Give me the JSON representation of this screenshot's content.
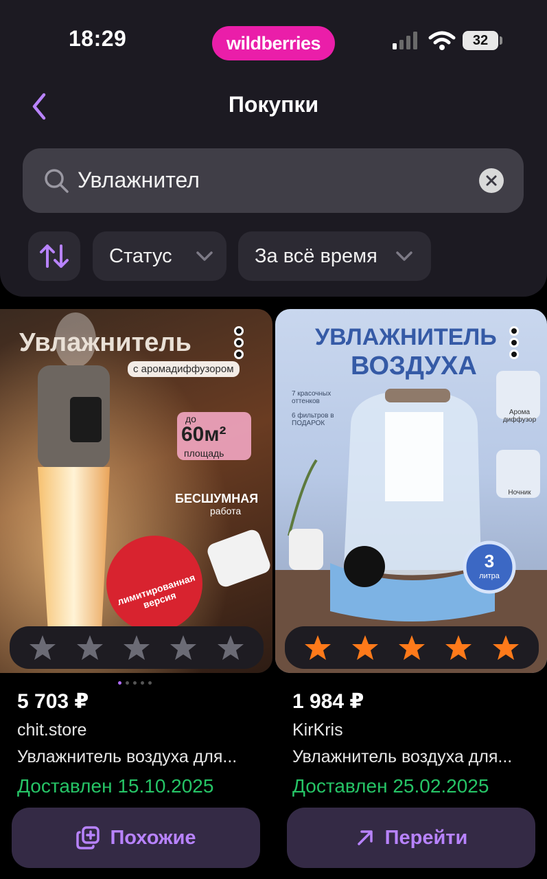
{
  "status_bar": {
    "time": "18:29",
    "brand": "wildberries",
    "battery": "32"
  },
  "header": {
    "title": "Покупки"
  },
  "search": {
    "value": "Увлажнител"
  },
  "filters": {
    "status_label": "Статус",
    "period_label": "За всё время"
  },
  "products": [
    {
      "image_title": "Увлажнитель",
      "image_subtitle": "с аромадиффузором",
      "image_badge_top": "до",
      "image_badge_value": "60м²",
      "image_badge_unit": "площадь",
      "image_feature_1": "БЕСШУМНАЯ",
      "image_feature_2": "работа",
      "image_sticker": "лимитированная версия",
      "rating": 0,
      "price": "5 703 ₽",
      "seller": "chit.store",
      "name": "Увлажнитель воздуха для...",
      "status": "Доставлен 15.10.2025",
      "action_label": "Похожие"
    },
    {
      "image_title_1": "УВЛАЖНИТЕЛЬ",
      "image_title_2": "ВОЗДУХА",
      "image_feature_1": "7 красочных оттенков",
      "image_feature_2": "6 фильтров в ПОДАРОК",
      "image_mode_1": "Арома диффузор",
      "image_mode_2": "Ночник",
      "image_volume_value": "3",
      "image_volume_unit": "литра",
      "rating": 5,
      "price": "1 984 ₽",
      "seller": "KirKris",
      "name": "Увлажнитель воздуха для...",
      "status": "Доставлен 25.02.2025",
      "action_label": "Перейти"
    }
  ],
  "colors": {
    "accent": "#b883ff",
    "brand": "#ea1ea9",
    "delivered": "#26c466",
    "star_filled": "#ff7a1a",
    "star_empty": "#6b6b75"
  }
}
